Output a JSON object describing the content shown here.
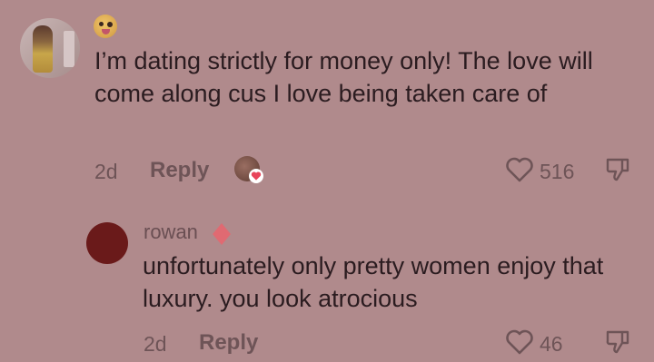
{
  "comment": {
    "text": "I’m dating strictly for money only! The love will come along cus I love being taken care of",
    "time": "2d",
    "reply_label": "Reply",
    "likes": "516",
    "icons": {
      "emoji": "grinning-tongue-emoji",
      "like": "heart-outline-icon",
      "dislike": "thumbs-down-icon",
      "liked_by": "heart-badge-icon"
    }
  },
  "reply": {
    "username": "rowan",
    "text": "unfortunately only pretty women enjoy that luxury. you look atrocious",
    "time": "2d",
    "reply_label": "Reply",
    "likes": "46",
    "icons": {
      "badge": "diamond-icon",
      "like": "heart-outline-icon",
      "dislike": "thumbs-down-icon"
    }
  },
  "colors": {
    "background": "#b08a8c",
    "text": "#2b1c20",
    "meta": "#6e5457",
    "accent": "#e8455b"
  }
}
